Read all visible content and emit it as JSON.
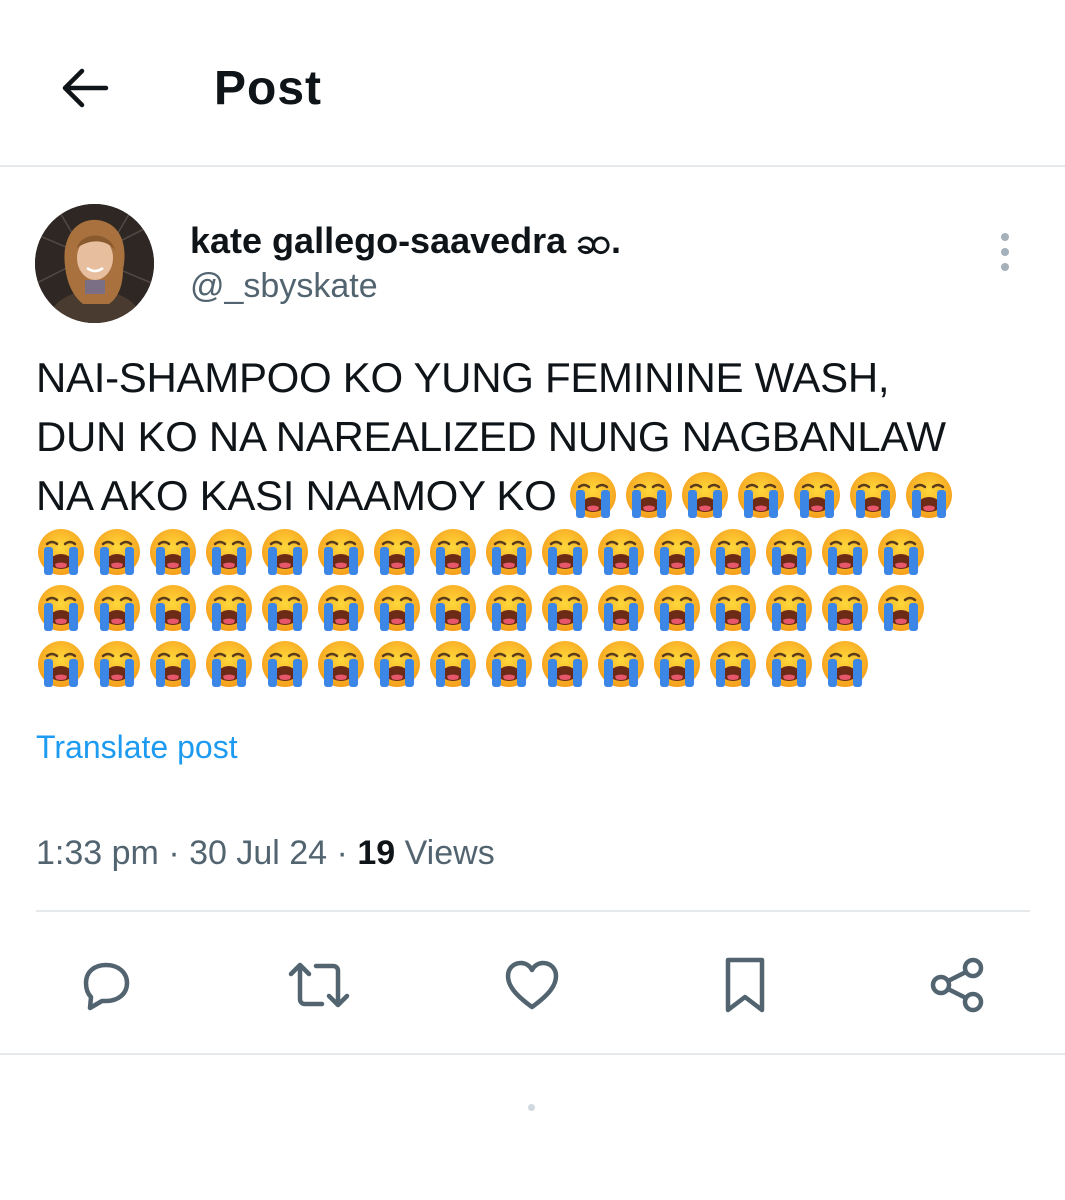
{
  "header": {
    "back_icon": "arrow-left-icon",
    "title": "Post"
  },
  "author": {
    "display_name": "kate gallego-saavedra ဆ.",
    "handle": "@_sbyskate",
    "avatar": "profile-photo",
    "more_icon": "more-vertical-icon"
  },
  "post": {
    "text_lines": [
      "NAI-SHAMPOO KO YUNG FEMININE WASH,",
      "DUN KO NA NAREALIZED NUNG NAGBANLAW",
      "NA AKO KASI NAAMOY KO"
    ],
    "emoji": "loudly-crying-face",
    "emoji_rows": [
      7,
      16,
      16,
      15
    ],
    "translate_label": "Translate post"
  },
  "meta": {
    "time": "1:33 pm",
    "date": "30 Jul 24",
    "separator": "·",
    "views_count": "19",
    "views_label": "Views"
  },
  "actions": [
    {
      "name": "reply",
      "icon": "reply-icon"
    },
    {
      "name": "repost",
      "icon": "repost-icon"
    },
    {
      "name": "like",
      "icon": "heart-icon"
    },
    {
      "name": "bookmark",
      "icon": "bookmark-icon"
    },
    {
      "name": "share",
      "icon": "share-icon"
    }
  ],
  "colors": {
    "text": "#0f1419",
    "secondary": "#536471",
    "link": "#1d9bf0",
    "divider": "#e6e9ec"
  }
}
